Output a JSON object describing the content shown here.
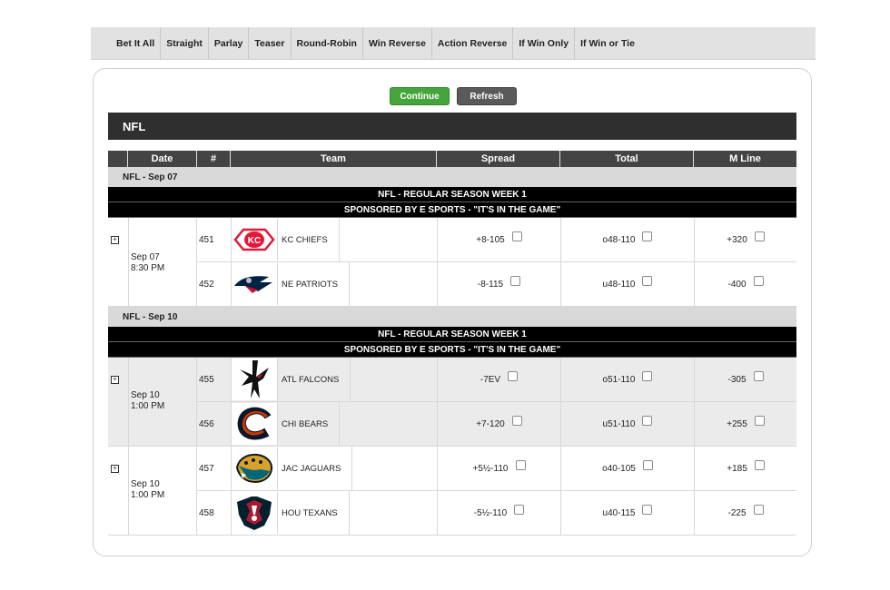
{
  "tabs": [
    "Bet It All",
    "Straight",
    "Parlay",
    "Teaser",
    "Round-Robin",
    "Win Reverse",
    "Action Reverse",
    "If Win Only",
    "If Win or Tie"
  ],
  "buttons": {
    "continue": "Continue",
    "refresh": "Refresh"
  },
  "sport_title": "NFL",
  "columns": {
    "date": "Date",
    "num": "#",
    "team": "Team",
    "spread": "Spread",
    "total": "Total",
    "mline": "M Line"
  },
  "sections": [
    {
      "date_label": "NFL - Sep 07",
      "league_line": "NFL - REGULAR SEASON WEEK 1",
      "sponsor_line": "SPONSORED BY E SPORTS - \"IT'S IN THE GAME\""
    },
    {
      "date_label": "NFL - Sep 10",
      "league_line": "NFL - REGULAR SEASON WEEK 1",
      "sponsor_line": "SPONSORED BY E SPORTS - \"IT'S IN THE GAME\""
    }
  ],
  "games": [
    {
      "date": "Sep 07",
      "time": "8:30 PM",
      "teams": [
        {
          "num": "451",
          "name": "KC CHIEFS",
          "logo": "chiefs-logo",
          "spread": "+8-105",
          "total": "o48-110",
          "ml": "+320"
        },
        {
          "num": "452",
          "name": "NE PATRIOTS",
          "logo": "patriots-logo",
          "spread": "-8-115",
          "total": "u48-110",
          "ml": "-400"
        }
      ]
    },
    {
      "date": "Sep 10",
      "time": "1:00 PM",
      "teams": [
        {
          "num": "455",
          "name": "ATL FALCONS",
          "logo": "falcons-logo",
          "spread": "-7EV",
          "total": "o51-110",
          "ml": "-305"
        },
        {
          "num": "456",
          "name": "CHI BEARS",
          "logo": "bears-logo",
          "spread": "+7-120",
          "total": "u51-110",
          "ml": "+255"
        }
      ]
    },
    {
      "date": "Sep 10",
      "time": "1:00 PM",
      "teams": [
        {
          "num": "457",
          "name": "JAC JAGUARS",
          "logo": "jaguars-logo",
          "spread": "+5½-110",
          "total": "o40-105",
          "ml": "+185"
        },
        {
          "num": "458",
          "name": "HOU TEXANS",
          "logo": "texans-logo",
          "spread": "-5½-110",
          "total": "u40-115",
          "ml": "-225"
        }
      ]
    }
  ],
  "expand_icon": "plus-box-icon"
}
